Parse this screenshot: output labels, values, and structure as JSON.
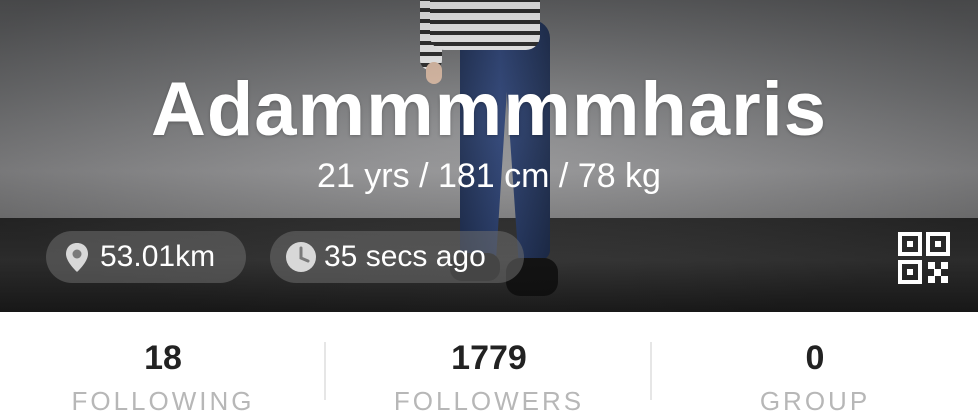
{
  "profile": {
    "username": "Adammmmmharis",
    "details": "21 yrs / 181 cm / 78 kg",
    "distance": "53.01km",
    "last_active": "35 secs ago"
  },
  "icons": {
    "location": "location-pin-icon",
    "time": "clock-icon",
    "qr": "qr-code-icon"
  },
  "stats": [
    {
      "count": "18",
      "label": "FOLLOWING"
    },
    {
      "count": "1779",
      "label": "FOLLOWERS"
    },
    {
      "count": "0",
      "label": "GROUP"
    }
  ],
  "colors": {
    "text_dark": "#222222",
    "label_gray": "#b7b7b7",
    "chip_bg": "rgba(110,110,110,0.55)"
  }
}
